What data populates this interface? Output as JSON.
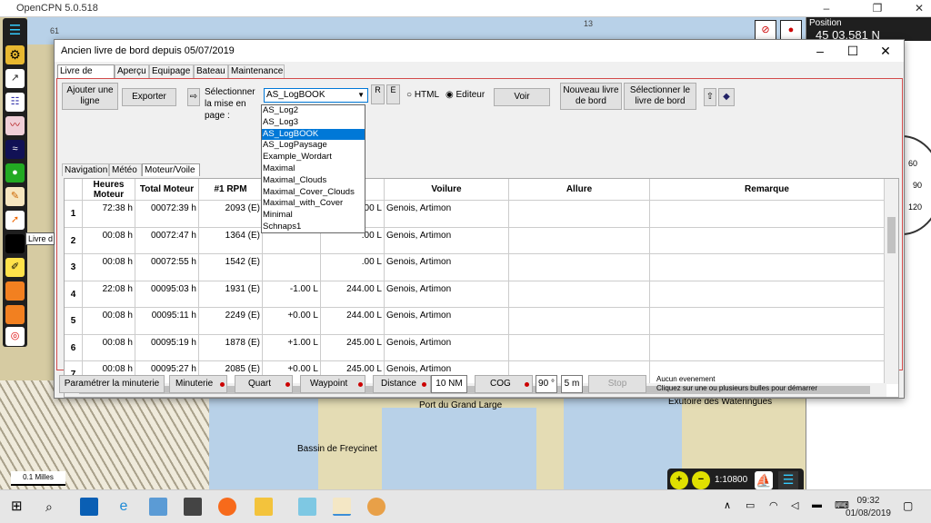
{
  "app": {
    "title": "OpenCPN 5.0.518"
  },
  "chart": {
    "label_port": "Port du Grand Large",
    "label_basin": "Bassin de Freycinet",
    "label_exutoire": "Exutoire des Wateringues",
    "scale_label": "0.1 Milles",
    "tooltip": "Livre d",
    "scale_value": "1:10800",
    "depth_a": "61",
    "depth_b": "13"
  },
  "right_panel": {
    "title": "Position",
    "value": "45 03.581 N",
    "compass_labels": [
      "60",
      "90",
      "120"
    ]
  },
  "dialog": {
    "title": "Ancien livre de bord depuis 05/07/2019",
    "tabs": [
      "Livre de bord",
      "Aperçu",
      "Equipage",
      "Bateau",
      "Maintenance"
    ],
    "buttons": {
      "add_line": "Ajouter une ligne",
      "export": "Exporter",
      "select_label": "Sélectionner la mise en page :",
      "r": "R",
      "e": "E",
      "html": "HTML",
      "editor": "Editeur",
      "view": "Voir",
      "new_log": "Nouveau livre de bord",
      "select_log": "Sélectionner le livre de bord"
    },
    "layout_select": {
      "value": "AS_LogBOOK",
      "options": [
        "AS_Log2",
        "AS_Log3",
        "AS_LogBOOK",
        "AS_LogPaysage",
        "Example_Wordart",
        "Maximal",
        "Maximal_Clouds",
        "Maximal_Cover_Clouds",
        "Maximal_with_Cover",
        "Minimal",
        "Schnaps1"
      ],
      "selected_index": 2
    },
    "subtabs": [
      "Navigation",
      "Météo",
      "Moteur/Voile"
    ],
    "columns": [
      "",
      "Heures Moteur",
      "Total Moteur",
      "#1 RPM",
      "",
      "",
      "Voilure",
      "Allure",
      "Remarque"
    ],
    "rows": [
      {
        "n": "1",
        "h": "72:38 h",
        "t": "00072:39 h",
        "rpm": "2093 (E)",
        "a": "",
        "b": ".00 L",
        "v": "Genois, Artimon"
      },
      {
        "n": "2",
        "h": "00:08 h",
        "t": "00072:47 h",
        "rpm": "1364 (E)",
        "a": "",
        "b": ".00 L",
        "v": "Genois, Artimon"
      },
      {
        "n": "3",
        "h": "00:08 h",
        "t": "00072:55 h",
        "rpm": "1542 (E)",
        "a": "",
        "b": ".00 L",
        "v": "Genois, Artimon"
      },
      {
        "n": "4",
        "h": "22:08 h",
        "t": "00095:03 h",
        "rpm": "1931 (E)",
        "a": "-1.00 L",
        "b": "244.00 L",
        "v": "Genois, Artimon"
      },
      {
        "n": "5",
        "h": "00:08 h",
        "t": "00095:11 h",
        "rpm": "2249 (E)",
        "a": "+0.00 L",
        "b": "244.00 L",
        "v": "Genois, Artimon"
      },
      {
        "n": "6",
        "h": "00:08 h",
        "t": "00095:19 h",
        "rpm": "1878 (E)",
        "a": "+1.00 L",
        "b": "245.00 L",
        "v": "Genois, Artimon"
      },
      {
        "n": "7",
        "h": "00:08 h",
        "t": "00095:27 h",
        "rpm": "2085 (E)",
        "a": "+0.00 L",
        "b": "245.00 L",
        "v": "Genois, Artimon"
      }
    ],
    "bottom": {
      "timer_settings": "Paramétrer la minuterie",
      "timer": "Minuterie",
      "watch": "Quart",
      "waypoint": "Waypoint",
      "distance": "Distance",
      "distance_value": "10 NM",
      "cog": "COG",
      "cog_value": "90 °",
      "minutes_value": "5 m",
      "stop": "Stop",
      "status_line1": "Aucun evenement",
      "status_line2": "Cliquez sur une ou plusieurs bulles pour démarrer"
    }
  },
  "taskbar": {
    "time": "09:32",
    "date": "01/08/2019"
  }
}
